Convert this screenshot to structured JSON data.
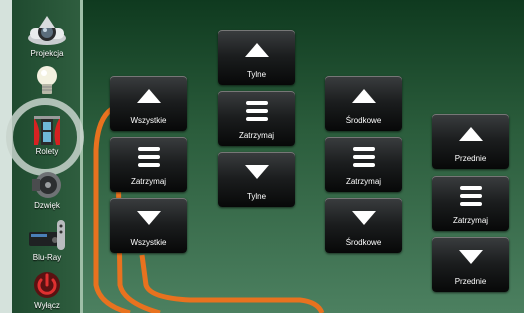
{
  "sidebar": {
    "items": [
      {
        "label": "Projekcja",
        "icon": "projector-icon"
      },
      {
        "label": "",
        "icon": "light-bulb-icon"
      },
      {
        "label": "Rolety",
        "icon": "blinds-icon",
        "active": true
      },
      {
        "label": "Dzwięk",
        "icon": "speaker-icon"
      },
      {
        "label": "Blu-Ray",
        "icon": "bluray-player-icon"
      },
      {
        "label": "Wyłącz",
        "icon": "power-icon"
      }
    ]
  },
  "controls": {
    "all": {
      "up": "Wszystkie",
      "stop": "Zatrzymaj",
      "down": "Wszystkie"
    },
    "rear": {
      "up": "Tylne",
      "stop": "Zatrzymaj",
      "down": "Tylne"
    },
    "middle": {
      "up": "Środkowe",
      "stop": "Zatrzymaj",
      "down": "Środkowe"
    },
    "front": {
      "up": "Przednie",
      "stop": "Zatrzymaj",
      "down": "Przednie"
    }
  },
  "colors": {
    "accent": "#e8721f",
    "button": "#1b1d1e",
    "background": "#2b5d3c"
  }
}
